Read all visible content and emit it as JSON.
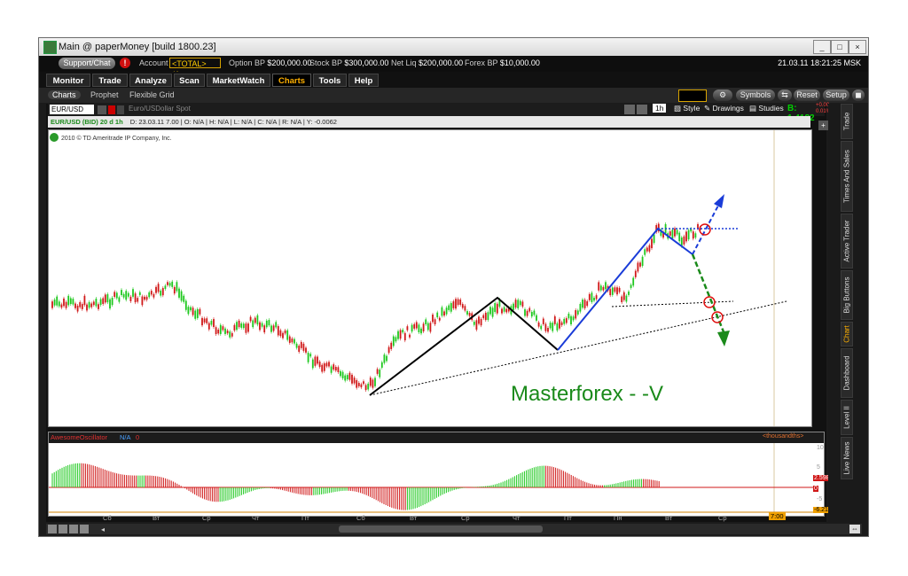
{
  "window": {
    "title": "Main @ paperMoney [build 1800.23]"
  },
  "account_bar": {
    "support_label": "Support/Chat",
    "alert_label": "!",
    "account_label": "Account",
    "account_value": "<TOTAL> (A...",
    "figures": [
      {
        "label": "Option BP",
        "value": "$200,000.00"
      },
      {
        "label": "Stock BP",
        "value": "$300,000.00"
      },
      {
        "label": "Net Liq",
        "value": "$200,000.00"
      },
      {
        "label": "Forex BP",
        "value": "$10,000.00"
      }
    ],
    "datetime": "21.03.11 18:21:25 MSK"
  },
  "main_tabs": [
    "Monitor",
    "Trade",
    "Analyze",
    "Scan",
    "MarketWatch",
    "Charts",
    "Tools",
    "Help"
  ],
  "active_tab": "Charts",
  "sub_tabs": [
    "Charts",
    "Prophet",
    "Flexible Grid"
  ],
  "toolbar_right": {
    "symbols": "Symbols",
    "reset": "Reset",
    "setup": "Setup"
  },
  "chart_header": {
    "symbol": "EUR/USD",
    "description": "Euro/USDollar Spot",
    "interval": "1h",
    "style": "Style",
    "drawings": "Drawings",
    "studies": "Studies",
    "bid_label": "B: 1.4182",
    "change_top": "+0.00",
    "change_bottom": "0.01%"
  },
  "info_row": {
    "series_name": "EUR/USD (BID) 20 d 1h",
    "fields": "D: 23.03.11 7.00 | O: N/A | H: N/A | L: N/A | C: N/A | R: N/A | Y: -0.0062"
  },
  "copyright": "2010 © TD Ameritrade IP Company, Inc.",
  "annotation": {
    "text": "Masterforex - -V",
    "color": "#1a8a1a"
  },
  "oscillator": {
    "name": "AwesomeOscillator",
    "val1": "N/A",
    "val2": "0",
    "units": "<thousandths>",
    "scale_labels": [
      "10",
      "5",
      "0",
      "-5"
    ],
    "current_value": "2.5986",
    "zero_label": "0",
    "bottom_value": "-6.21"
  },
  "time_axis": [
    "Сб",
    "Вт",
    "Ср",
    "Чт",
    "Пт",
    "Сб",
    "Вт",
    "Ср",
    "Чт",
    "Пт",
    "Пн",
    "Вт",
    "Ср",
    "Чт"
  ],
  "time_marker": "7:00",
  "side_tabs": [
    "Trade",
    "Times And Sales",
    "Active Trader",
    "Big Buttons",
    "Chart",
    "Dashboard",
    "Level II",
    "Live News"
  ],
  "active_side_tab": "Chart",
  "colors": {
    "up": "#1ec81e",
    "down": "#d01818",
    "accent": "#ffb000"
  }
}
